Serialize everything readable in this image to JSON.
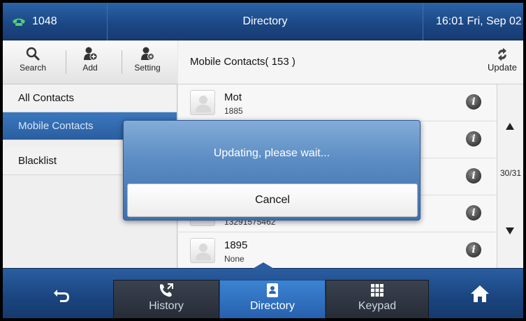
{
  "status_bar": {
    "line_number": "1048",
    "title": "Directory",
    "datetime": "16:01 Fri, Sep 02"
  },
  "toolbar": {
    "search_label": "Search",
    "add_label": "Add",
    "setting_label": "Setting"
  },
  "groups": [
    {
      "label": "All Contacts",
      "selected": false
    },
    {
      "label": "Mobile Contacts",
      "selected": true
    },
    {
      "label": "Blacklist",
      "selected": false
    }
  ],
  "list_header": {
    "title": "Mobile Contacts( 153 )",
    "update_label": "Update"
  },
  "contacts": [
    {
      "name": "Mot",
      "number": "1885"
    },
    {
      "name": "",
      "number": ""
    },
    {
      "name": "",
      "number": ""
    },
    {
      "name": "",
      "number": "13291575462"
    },
    {
      "name": "1895",
      "number": "None"
    }
  ],
  "pagination": {
    "indicator": "30/31"
  },
  "dialog": {
    "message": "Updating, please wait...",
    "cancel_label": "Cancel"
  },
  "bottom_bar": {
    "history_label": "History",
    "directory_label": "Directory",
    "keypad_label": "Keypad",
    "active_tab": "Directory"
  },
  "colors": {
    "accent_blue": "#2a5e9f",
    "active_tab": "#2f6fbf",
    "dialog_blue": "#5b8cc3"
  }
}
